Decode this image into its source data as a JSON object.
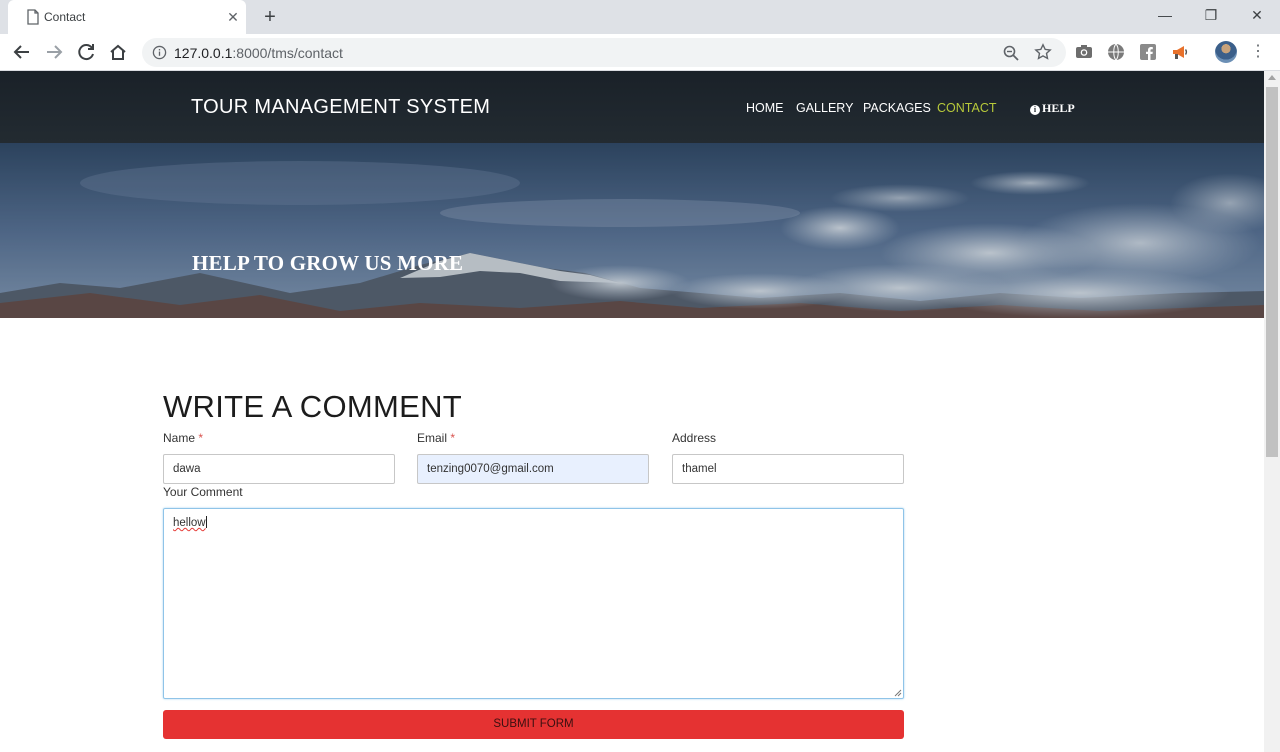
{
  "browser": {
    "tab_title": "Contact",
    "tab_close_icon": "close-icon",
    "new_tab_symbol": "+",
    "url_host": "127.0.0.1",
    "url_path": ":8000/tms/contact",
    "window": {
      "minimize": "—",
      "maximize": "❐",
      "close": "✕"
    },
    "menu_symbol": "⋮"
  },
  "site": {
    "brand": "TOUR MANAGEMENT SYSTEM",
    "nav": {
      "home": "HOME",
      "gallery": "GALLERY",
      "packages": "PACKAGES",
      "contact": "CONTACT",
      "help": "HELP",
      "help_icon": "i"
    },
    "active_nav_color": "#b7c93a"
  },
  "hero": {
    "title": "HELP TO GROW US MORE"
  },
  "form": {
    "title": "WRITE A COMMENT",
    "required_mark": "*",
    "name_label": "Name",
    "name_value": "dawa",
    "email_label": "Email",
    "email_value": "tenzing0070@gmail.com",
    "address_label": "Address",
    "address_value": "thamel",
    "comment_label": "Your Comment",
    "comment_value": "hellow",
    "submit_label": "SUBMIT FORM",
    "submit_color": "#e53232"
  }
}
